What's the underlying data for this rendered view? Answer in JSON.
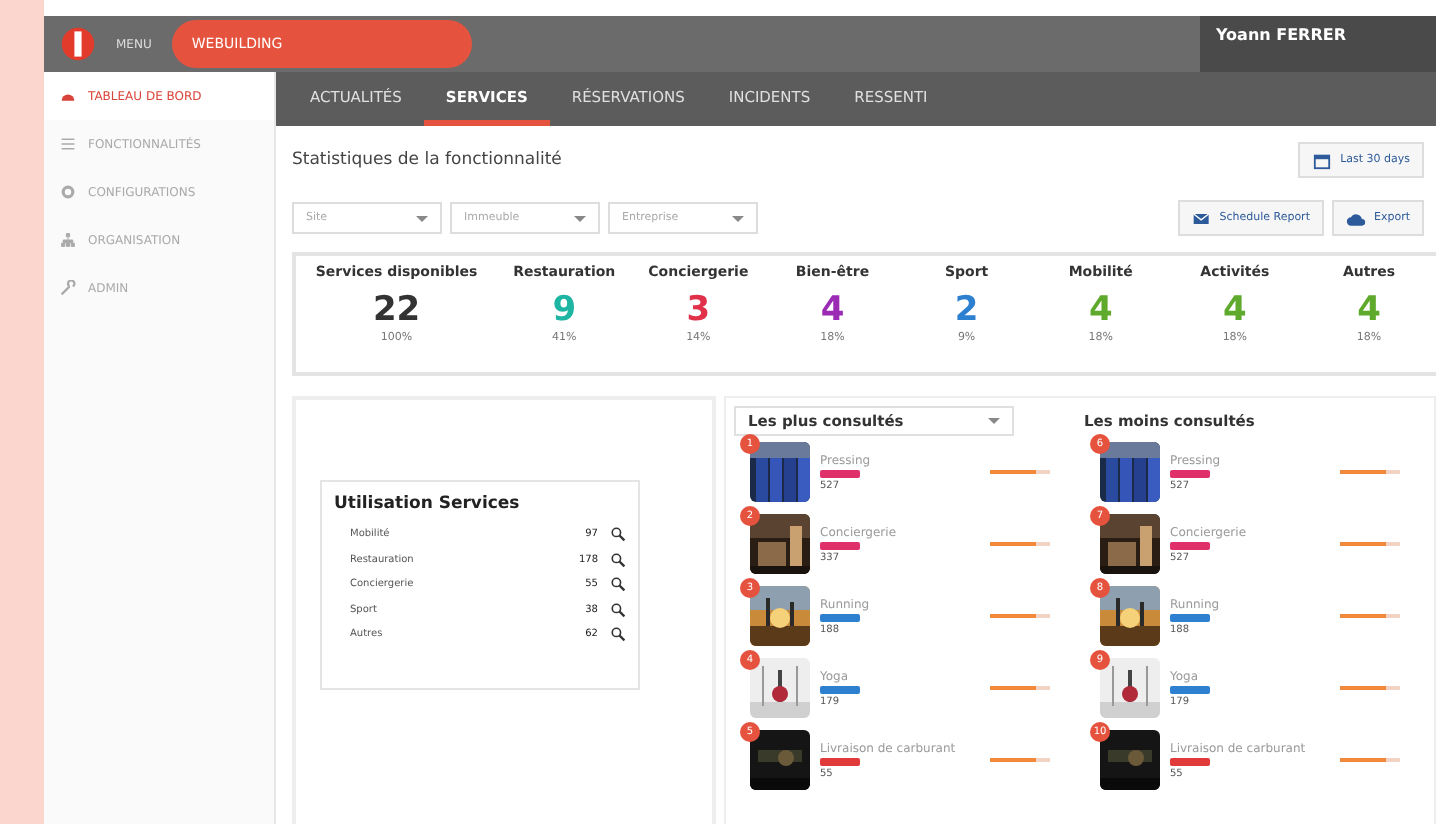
{
  "header": {
    "menu_label": "MENU",
    "brand": "WEBUILDING",
    "user": "Yoann FERRER"
  },
  "sidebar": {
    "items": [
      {
        "label": "TABLEAU DE BORD",
        "selected": true
      },
      {
        "label": "FONCTIONNALITÉS",
        "selected": false
      },
      {
        "label": "CONFIGURATIONS",
        "selected": false
      },
      {
        "label": "ORGANISATION",
        "selected": false
      },
      {
        "label": "ADMIN",
        "selected": false
      }
    ]
  },
  "tabs": [
    {
      "label": "ACTUALITÉS",
      "selected": false
    },
    {
      "label": "SERVICES",
      "selected": true
    },
    {
      "label": "RÉSERVATIONS",
      "selected": false
    },
    {
      "label": "INCIDENTS",
      "selected": false
    },
    {
      "label": "RESSENTI",
      "selected": false
    }
  ],
  "page_title": "Statistiques de la fonctionnalité",
  "date_range": "Last 30 days",
  "filters": [
    {
      "placeholder": "Site"
    },
    {
      "placeholder": "Immeuble"
    },
    {
      "placeholder": "Entreprise"
    }
  ],
  "actions": [
    {
      "label": "Schedule Report"
    },
    {
      "label": "Export"
    }
  ],
  "stats": [
    {
      "label": "Services disponibles",
      "value": "22",
      "percent": "100%",
      "color": "#333333"
    },
    {
      "label": "Restauration",
      "value": "9",
      "percent": "41%",
      "color": "#1fb5a3"
    },
    {
      "label": "Conciergerie",
      "value": "3",
      "percent": "14%",
      "color": "#e0304a"
    },
    {
      "label": "Bien-être",
      "value": "4",
      "percent": "18%",
      "color": "#9b2bb5"
    },
    {
      "label": "Sport",
      "value": "2",
      "percent": "9%",
      "color": "#2d7fd0"
    },
    {
      "label": "Mobilité",
      "value": "4",
      "percent": "18%",
      "color": "#5faa2c"
    },
    {
      "label": "Activités",
      "value": "4",
      "percent": "18%",
      "color": "#5faa2c"
    },
    {
      "label": "Autres",
      "value": "4",
      "percent": "18%",
      "color": "#5faa2c"
    }
  ],
  "usage": {
    "title": "Utilisation Services",
    "rows": [
      {
        "name": "Mobilité",
        "count": "97"
      },
      {
        "name": "Restauration",
        "count": "178"
      },
      {
        "name": "Conciergerie",
        "count": "55"
      },
      {
        "name": "Sport",
        "count": "38"
      },
      {
        "name": "Autres",
        "count": "62"
      }
    ]
  },
  "most_viewed": {
    "title": "Les plus consultés",
    "items": [
      {
        "rank": "1",
        "name": "Pressing",
        "color": "#e0306a",
        "views": "527",
        "level": 0.75
      },
      {
        "rank": "2",
        "name": "Conciergerie",
        "color": "#e0306a",
        "views": "337",
        "level": 0.75
      },
      {
        "rank": "3",
        "name": "Running",
        "color": "#2d7fd0",
        "views": "188",
        "level": 0.75
      },
      {
        "rank": "4",
        "name": "Yoga",
        "color": "#2d7fd0",
        "views": "179",
        "level": 0.75
      },
      {
        "rank": "5",
        "name": "Livraison de carburant",
        "color": "#e03a3a",
        "views": "55",
        "level": 0.75
      }
    ]
  },
  "least_viewed": {
    "title": "Les moins consultés",
    "items": [
      {
        "rank": "6",
        "name": "Pressing",
        "color": "#e0306a",
        "views": "527",
        "level": 0.75
      },
      {
        "rank": "7",
        "name": "Conciergerie",
        "color": "#e0306a",
        "views": "527",
        "level": 0.75
      },
      {
        "rank": "8",
        "name": "Running",
        "color": "#2d7fd0",
        "views": "188",
        "level": 0.75
      },
      {
        "rank": "9",
        "name": "Yoga",
        "color": "#2d7fd0",
        "views": "179",
        "level": 0.75
      },
      {
        "rank": "10",
        "name": "Livraison de carburant",
        "color": "#e03a3a",
        "views": "55",
        "level": 0.75
      }
    ]
  }
}
